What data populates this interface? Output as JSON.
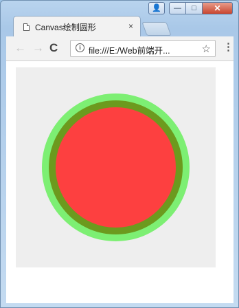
{
  "window": {
    "caption_buttons": {
      "user": "👤",
      "minimize": "—",
      "maximize": "□",
      "close": "✕"
    }
  },
  "tabs": [
    {
      "title": "Canvas绘制圆形",
      "close_label": "×",
      "active": true
    }
  ],
  "toolbar": {
    "back_label": "←",
    "forward_label": "→",
    "reload_label": "C",
    "info_label": "i",
    "url": "file:///E:/Web前端开...",
    "bookmark_label": "☆",
    "menu_label": "⋮"
  },
  "canvas": {
    "background": "#eeeeee",
    "outer_ring_color": "#7def73",
    "inner_ring_color": "#6c9a1e",
    "fill_color": "#fd4040"
  }
}
